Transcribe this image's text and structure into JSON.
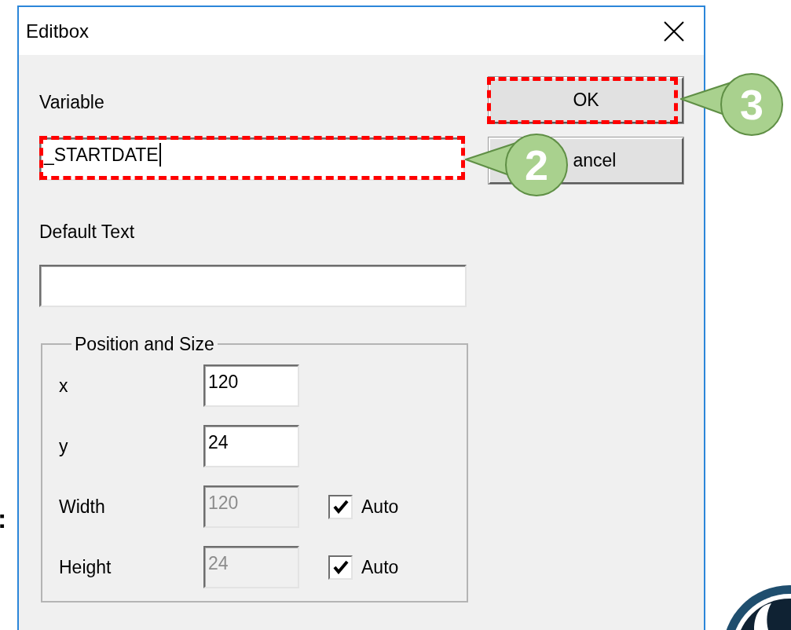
{
  "window": {
    "title": "Editbox"
  },
  "variable": {
    "label": "Variable",
    "value": "_STARTDATE",
    "caret": true
  },
  "default_text": {
    "label": "Default Text"
  },
  "buttons": [
    {
      "label": "OK"
    },
    {
      "label": "ancel"
    }
  ],
  "group": {
    "title": "Position and Size",
    "rows": [
      {
        "label": "x",
        "value": "120",
        "disabled": false
      },
      {
        "label": "y",
        "value": "24",
        "disabled": false
      },
      {
        "label": "Width",
        "value": "120",
        "disabled": true,
        "auto": {
          "label": "Auto",
          "checked": true
        }
      },
      {
        "label": "Height",
        "value": "24",
        "disabled": true,
        "auto": {
          "label": "Auto",
          "checked": true
        }
      }
    ]
  },
  "annotations": [
    {
      "number": "2"
    },
    {
      "number": "3"
    }
  ],
  "edge_text": ":"
}
